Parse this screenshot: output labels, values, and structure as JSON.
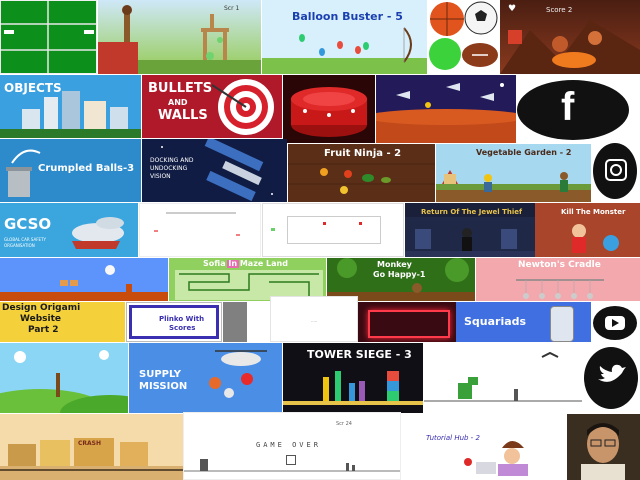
{
  "tiles": {
    "balloon_buster": {
      "title": "Balloon Buster - 5"
    },
    "angry_bird": {
      "score": "Scr 1"
    },
    "fireball": {
      "score": "Score 2"
    },
    "objects": {
      "title": "OBJECTS"
    },
    "bullets": {
      "title_line1": "BULLETS",
      "title_line2": "AND",
      "title_line3": "WALLS"
    },
    "crumpled": {
      "title": "Crumpled Balls-3"
    },
    "docking": {
      "line1": "DOCKING AND",
      "line2": "UNDOCKING",
      "line3": "VISION"
    },
    "fruit_ninja": {
      "title": "Fruit Ninja - 2"
    },
    "vegetable_garden": {
      "title": "Vegetable Garden - 2"
    },
    "gcso": {
      "logo": "GCSO",
      "tag_line1": "GLOBAL CAR SAFETY",
      "tag_line2": "ORGANISATION"
    },
    "jewel_thief": {
      "title": "Return Of The Jewel Thief"
    },
    "kill_monster": {
      "title": "Kill The Monster"
    },
    "sofia": {
      "title": "Sofia In Maze Land"
    },
    "monkey": {
      "title_line1": "Monkey",
      "title_line2": "Go Happy-1"
    },
    "newton": {
      "title": "Newton's Cradle"
    },
    "origami": {
      "line1": "Design Origami",
      "line2": "Website",
      "line3": "Part 2"
    },
    "plinko": {
      "line1": "Plinko With",
      "line2": "Scores"
    },
    "squariads": {
      "title": "Squariads"
    },
    "supply": {
      "line1": "SUPPLY",
      "line2": "MISSION"
    },
    "tower_siege": {
      "title": "TOWER SIEGE - 3"
    },
    "gameover": {
      "text": "GAME OVER",
      "score": "Scr 24"
    },
    "tutorial": {
      "title": "Tutorial Hub - 2"
    },
    "western": {
      "sign": "CRASH"
    }
  },
  "icons": {
    "facebook": "facebook-icon",
    "instagram": "instagram-icon",
    "youtube": "youtube-icon",
    "twitter": "twitter-icon"
  },
  "colors": {
    "facebook_bg": "#111111",
    "balloon_title": "#1a3fb0",
    "objects_sky": "#2c8fd6",
    "squariads_bg": "#3f6fe0"
  }
}
